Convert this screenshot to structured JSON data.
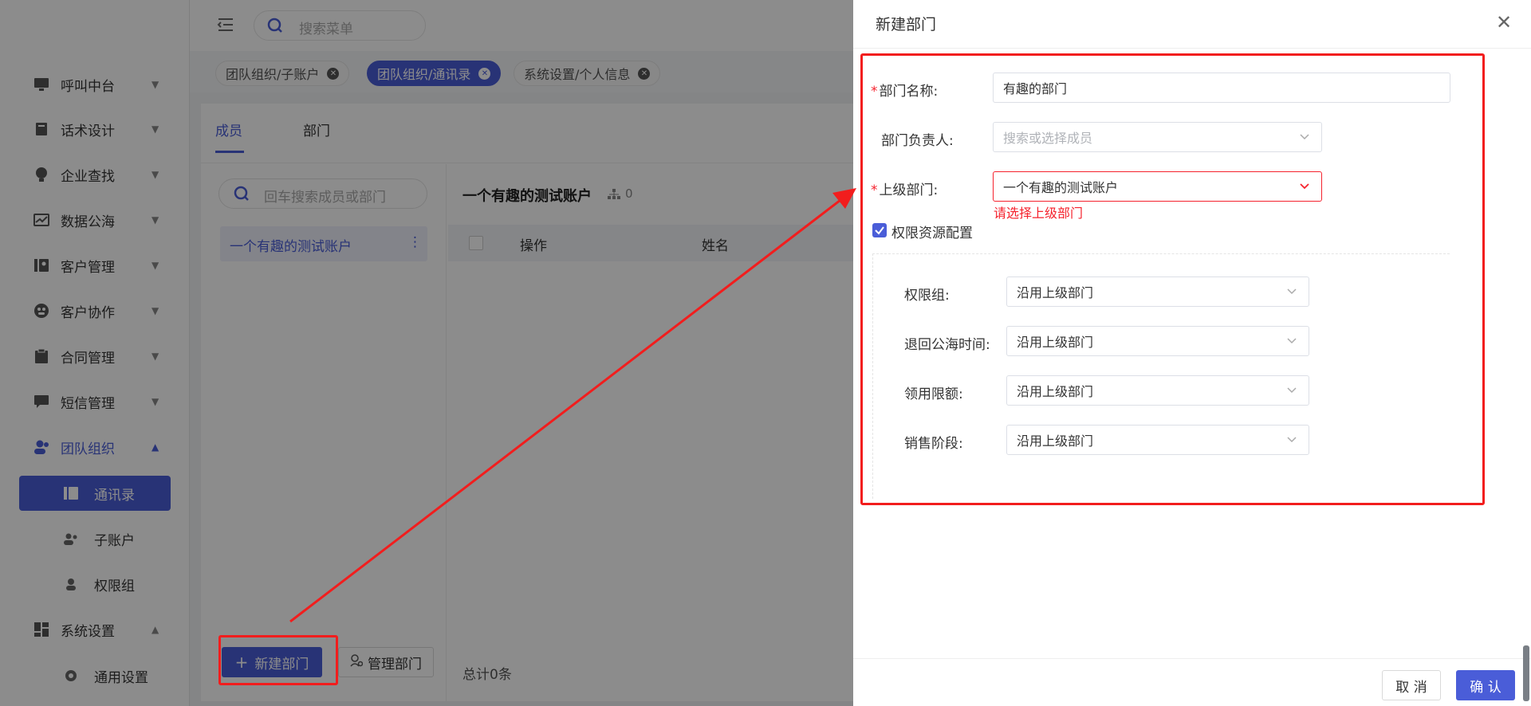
{
  "topbar": {
    "search_placeholder": "搜索菜单"
  },
  "tags": [
    {
      "label": "团队组织/子账户",
      "active": false
    },
    {
      "label": "团队组织/通讯录",
      "active": true
    },
    {
      "label": "系统设置/个人信息",
      "active": false
    }
  ],
  "sidebar": {
    "items": [
      {
        "label": "呼叫中台",
        "icon": "monitor-icon"
      },
      {
        "label": "话术设计",
        "icon": "book-icon"
      },
      {
        "label": "企业查找",
        "icon": "bulb-icon"
      },
      {
        "label": "数据公海",
        "icon": "chart-icon"
      },
      {
        "label": "客户管理",
        "icon": "contacts-icon"
      },
      {
        "label": "客户协作",
        "icon": "collab-icon"
      },
      {
        "label": "合同管理",
        "icon": "clipboard-icon"
      },
      {
        "label": "短信管理",
        "icon": "message-icon"
      },
      {
        "label": "团队组织",
        "icon": "team-icon"
      },
      {
        "label": "系统设置",
        "icon": "dashboard-icon"
      }
    ],
    "team_sub": [
      {
        "label": "通讯录"
      },
      {
        "label": "子账户"
      },
      {
        "label": "权限组"
      }
    ],
    "settings_sub": [
      {
        "label": "通用设置"
      }
    ]
  },
  "main": {
    "tab_members": "成员",
    "tab_departments": "部门",
    "member_search_placeholder": "回车搜索成员或部门",
    "account_name": "一个有趣的测试账户",
    "header_title": "一个有趣的测试账户",
    "member_count": "0",
    "col_action": "操作",
    "col_name": "姓名",
    "total": "总计0条",
    "new_dept_button": "新建部门",
    "manage_dept_button": "管理部门"
  },
  "drawer": {
    "title": "新建部门",
    "dept_name_label": "部门名称:",
    "dept_name_value": "有趣的部门",
    "leader_label": "部门负责人:",
    "leader_placeholder": "搜索或选择成员",
    "parent_label": "上级部门:",
    "parent_value": "一个有趣的测试账户",
    "parent_error": "请选择上级部门",
    "perm_checkbox_label": "权限资源配置",
    "perm_group_label": "权限组:",
    "perm_group_value": "沿用上级部门",
    "return_time_label": "退回公海时间:",
    "return_time_value": "沿用上级部门",
    "claim_limit_label": "领用限额:",
    "claim_limit_value": "沿用上级部门",
    "sales_stage_label": "销售阶段:",
    "sales_stage_value": "沿用上级部门",
    "cancel_button": "取 消",
    "confirm_button": "确 认"
  },
  "colors": {
    "primary": "#4a5dd8",
    "error": "#f5222d",
    "annotation": "#f21d1d"
  }
}
